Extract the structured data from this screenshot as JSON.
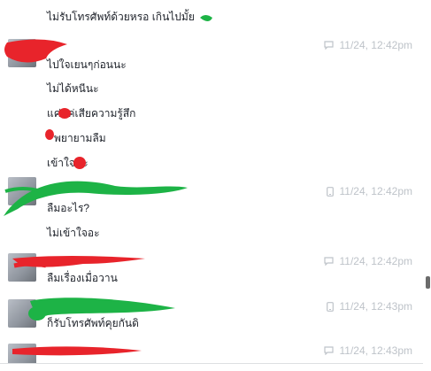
{
  "conversation": {
    "messages": [
      {
        "text": "ไม่รับโทรศัพท์ด้วยหรอ เกินไปมั้ย"
      },
      {
        "text": "ไปใจเยนๆก่อนนะ",
        "time": "11/24, 12:42pm",
        "device": "chat-bubble-icon"
      },
      {
        "text": "ไม่ได้หนีนะ"
      },
      {
        "text": "แค่แค่เสียความรู้สึก"
      },
      {
        "text": "พยายามลืม"
      },
      {
        "text": "เข้าใจนะ"
      },
      {
        "text": "ลืมอะไร?",
        "time": "11/24, 12:42pm",
        "device": "mobile-phone-icon"
      },
      {
        "text": "ไม่เข้าใจอะ"
      },
      {
        "text": "ลืมเรื่องเมื่อวาน",
        "time": "11/24, 12:42pm",
        "device": "chat-bubble-icon"
      },
      {
        "text": "ก็รับโทรศัพท์คุยกันดิ",
        "time": "11/24, 12:43pm",
        "device": "mobile-phone-icon"
      },
      {
        "time": "11/24, 12:43pm",
        "device": "chat-bubble-icon"
      }
    ]
  },
  "colors": {
    "redaction_red": "#e8242b",
    "redaction_green": "#1db346",
    "timestamp_gray": "#bec3c9"
  }
}
